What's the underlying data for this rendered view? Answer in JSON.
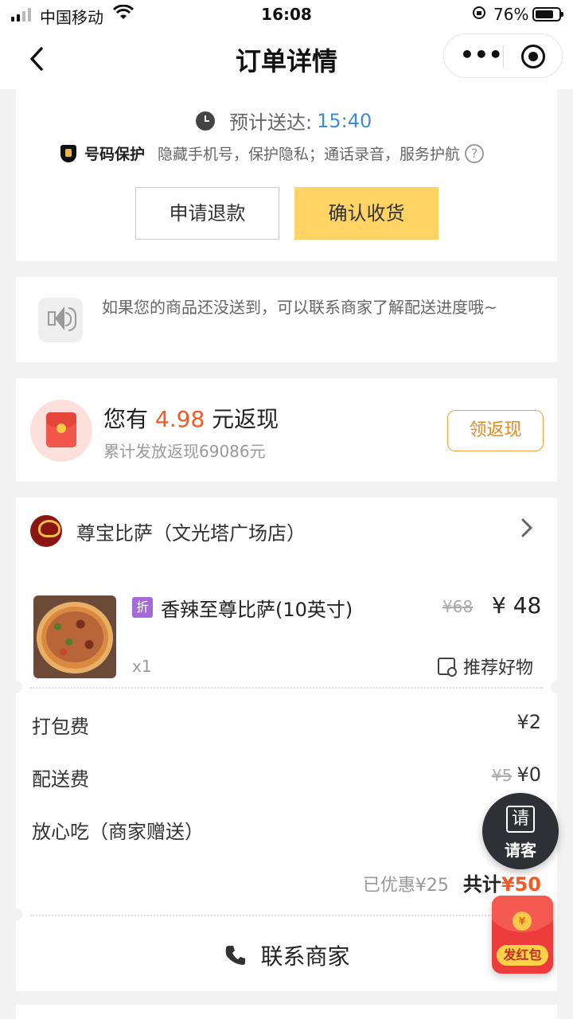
{
  "status_bar": {
    "carrier": "中国移动",
    "time": "16:08",
    "battery": "76%"
  },
  "nav": {
    "title": "订单详情",
    "back_icon": "chevron-left-icon",
    "more_icon": "more-dots-icon",
    "close_icon": "target-circle-icon"
  },
  "delivery": {
    "eta_label": "预计送达:",
    "eta_time": "15:40",
    "protect_name": "号码保护",
    "protect_desc": "隐藏手机号，保护隐私；通话录音，服务护航",
    "refund_btn": "申请退款",
    "confirm_btn": "确认收货"
  },
  "notice": {
    "text": "如果您的商品还没送到，可以联系商家了解配送进度哦~"
  },
  "cashback": {
    "prefix": "您有",
    "amount": "4.98",
    "suffix": "元返现",
    "sub": "累计发放返现69086元",
    "button": "领返现"
  },
  "order": {
    "shop_name": "尊宝比萨（文光塔广场店）",
    "item": {
      "tag": "折",
      "name": "香辣至尊比萨(10英寸)",
      "original_price": "¥68",
      "price": "¥ 48",
      "qty": "x1",
      "recommend": "推荐好物"
    },
    "fees": [
      {
        "label": "打包费",
        "original": "",
        "value": "¥2"
      },
      {
        "label": "配送费",
        "original": "¥5",
        "value": "¥0"
      },
      {
        "label": "放心吃（商家赠送）",
        "original": "",
        "value": ""
      }
    ],
    "saved": "已优惠¥25",
    "total_label": "共计",
    "total_value": "¥50",
    "contact": "联系商家"
  },
  "floating": {
    "treat_icon_char": "请",
    "treat_label": "请客",
    "hongbao_coin": "¥",
    "hongbao_label": "发红包"
  },
  "colors": {
    "accent_yellow": "#ffd465",
    "price_red": "#f15a2b",
    "eta_blue": "#3a8fd8",
    "cash_orange": "#e8891d"
  }
}
